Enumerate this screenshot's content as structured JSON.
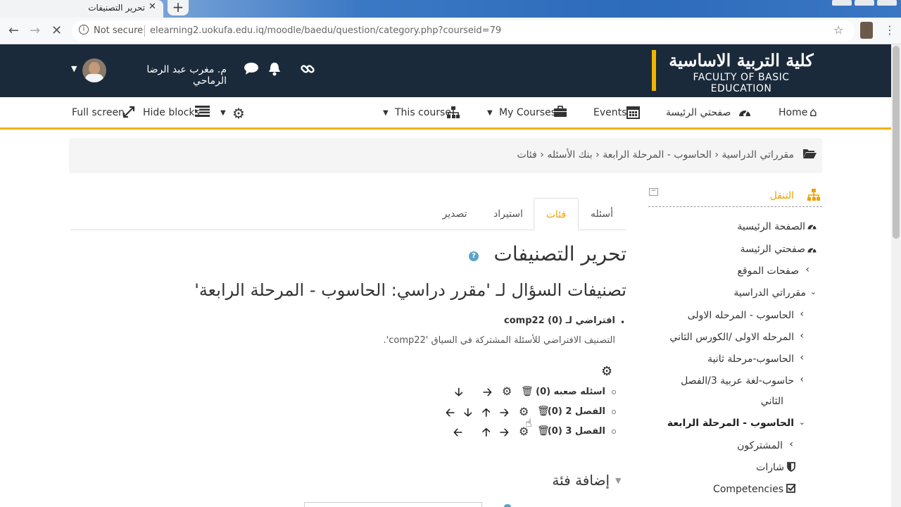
{
  "browser": {
    "tab_title": "تحرير التصنيفات",
    "tab_close": "✕",
    "new_tab": "+",
    "not_secure": "Not secure",
    "url": "elearning2.uokufa.edu.iq/moodle/baedu/question/category.php?courseid=79"
  },
  "header": {
    "logo_ar": "كلية التربية الاساسية",
    "logo_en": "FACULTY OF BASIC EDUCATION",
    "user_name": "م. مغرب عبد الرضا الرماحي"
  },
  "navbar": {
    "home": "Home",
    "dashboard": "صفحتي الرئيسة",
    "events": "Events",
    "my_courses": "My Courses",
    "this_course": "This course",
    "hide_blocks": "Hide blocks",
    "full_screen": "Full screen"
  },
  "breadcrumb": {
    "items": [
      "مقرراتي الدراسية",
      "الحاسوب - المرحلة الرابعة",
      "بنك الأسئله",
      "فئات"
    ]
  },
  "navigation": {
    "title": "التنقل",
    "items": [
      {
        "label": "الصفحة الرئيسية"
      },
      {
        "label": "صفحتي الرئيسة"
      },
      {
        "label": "صفحات الموقع"
      },
      {
        "label": "مقرراتي الدراسية"
      },
      {
        "label": "الحاسوب - المرحله الاولى"
      },
      {
        "label": "المرحله الاولى /الكورس الثاني"
      },
      {
        "label": "الحاسوب-مرحلة ثانية"
      },
      {
        "label": "حاسوب-لغة عربية 3/الفصل"
      },
      {
        "label": "الثاني"
      },
      {
        "label": "الحاسوب - المرحلة الرابعة"
      },
      {
        "label": "المشتركون"
      },
      {
        "label": "شارات"
      },
      {
        "label": "Competencies"
      }
    ]
  },
  "tabs": [
    {
      "label": "أسئله"
    },
    {
      "label": "فئات"
    },
    {
      "label": "استيراد"
    },
    {
      "label": "تصدير"
    }
  ],
  "main": {
    "heading": "تحرير التصنيفات",
    "subheading": "تصنيفات السؤال لـ 'مقرر دراسي: الحاسوب - المرحلة الرابعة'",
    "default_category": "افتراضي لـ comp22 (0)",
    "default_description": "التصنيف الافتراضي للأسئلة المشتركة في السياق 'comp22'.",
    "categories": [
      {
        "label": "اسئله صعبه (0)"
      },
      {
        "label": "الفصل 2 (0)"
      },
      {
        "label": "الفصل 3 (0)"
      }
    ],
    "add_category": "إضافة فئة"
  },
  "colors": {
    "accent": "#f0b400",
    "header_bg": "#1a2a3a",
    "nav_orange": "#f0a000"
  },
  "icons": [
    "cog-icon",
    "trash-icon",
    "arrow-left-icon",
    "arrow-right-icon",
    "arrow-up-icon",
    "arrow-down-icon",
    "help-icon",
    "bell-icon",
    "chat-icon",
    "link-icon",
    "home-icon",
    "calendar-icon",
    "briefcase-icon",
    "sitemap-icon",
    "expand-icon",
    "list-icon",
    "folder-icon"
  ]
}
